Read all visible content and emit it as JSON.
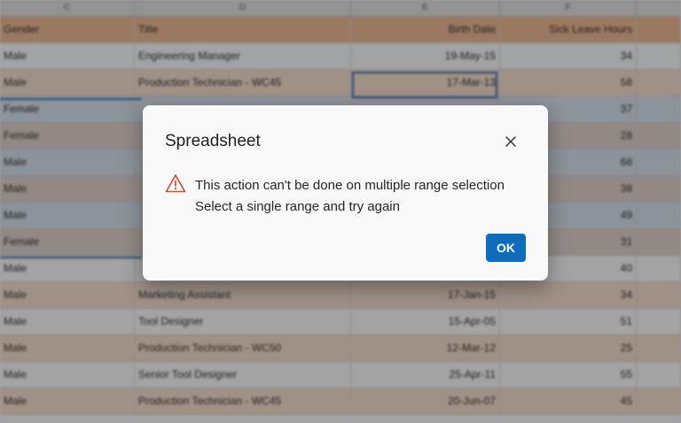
{
  "sheet": {
    "column_letters": [
      "C",
      "D",
      "E",
      "F"
    ],
    "headers": {
      "gender": "Gender",
      "title": "Title",
      "birth": "Birth Date",
      "sick": "Sick Leave Hours"
    },
    "rows": [
      {
        "gender": "Male",
        "title": "Engineering Manager",
        "birth": "19-May-15",
        "sick": "34"
      },
      {
        "gender": "Male",
        "title": "Production Technician - WC45",
        "birth": "17-Mar-13",
        "sick": "58"
      },
      {
        "gender": "Female",
        "title": "",
        "birth": "",
        "sick": "37"
      },
      {
        "gender": "Female",
        "title": "",
        "birth": "",
        "sick": "28"
      },
      {
        "gender": "Male",
        "title": "",
        "birth": "",
        "sick": "68"
      },
      {
        "gender": "Male",
        "title": "",
        "birth": "",
        "sick": "38"
      },
      {
        "gender": "Male",
        "title": "",
        "birth": "",
        "sick": "49"
      },
      {
        "gender": "Female",
        "title": "",
        "birth": "",
        "sick": "31"
      },
      {
        "gender": "Male",
        "title": "",
        "birth": "",
        "sick": "40"
      },
      {
        "gender": "Male",
        "title": "Marketing Assistant",
        "birth": "17-Jan-15",
        "sick": "34"
      },
      {
        "gender": "Male",
        "title": "Tool Designer",
        "birth": "15-Apr-05",
        "sick": "51"
      },
      {
        "gender": "Male",
        "title": "Production Technician - WC50",
        "birth": "12-Mar-12",
        "sick": "25"
      },
      {
        "gender": "Male",
        "title": "Senior Tool Designer",
        "birth": "25-Apr-11",
        "sick": "55"
      },
      {
        "gender": "Male",
        "title": "Production Technician - WC45",
        "birth": "20-Jun-07",
        "sick": "45"
      }
    ]
  },
  "dialog": {
    "title": "Spreadsheet",
    "message_line1": "This action can't be done on multiple range selection",
    "message_line2": "Select a single range and try again",
    "ok_label": "OK",
    "close_icon": "close-icon",
    "warning_icon": "warning-icon",
    "accent": "#0f6cbd",
    "warning_color": "#c4512a"
  }
}
